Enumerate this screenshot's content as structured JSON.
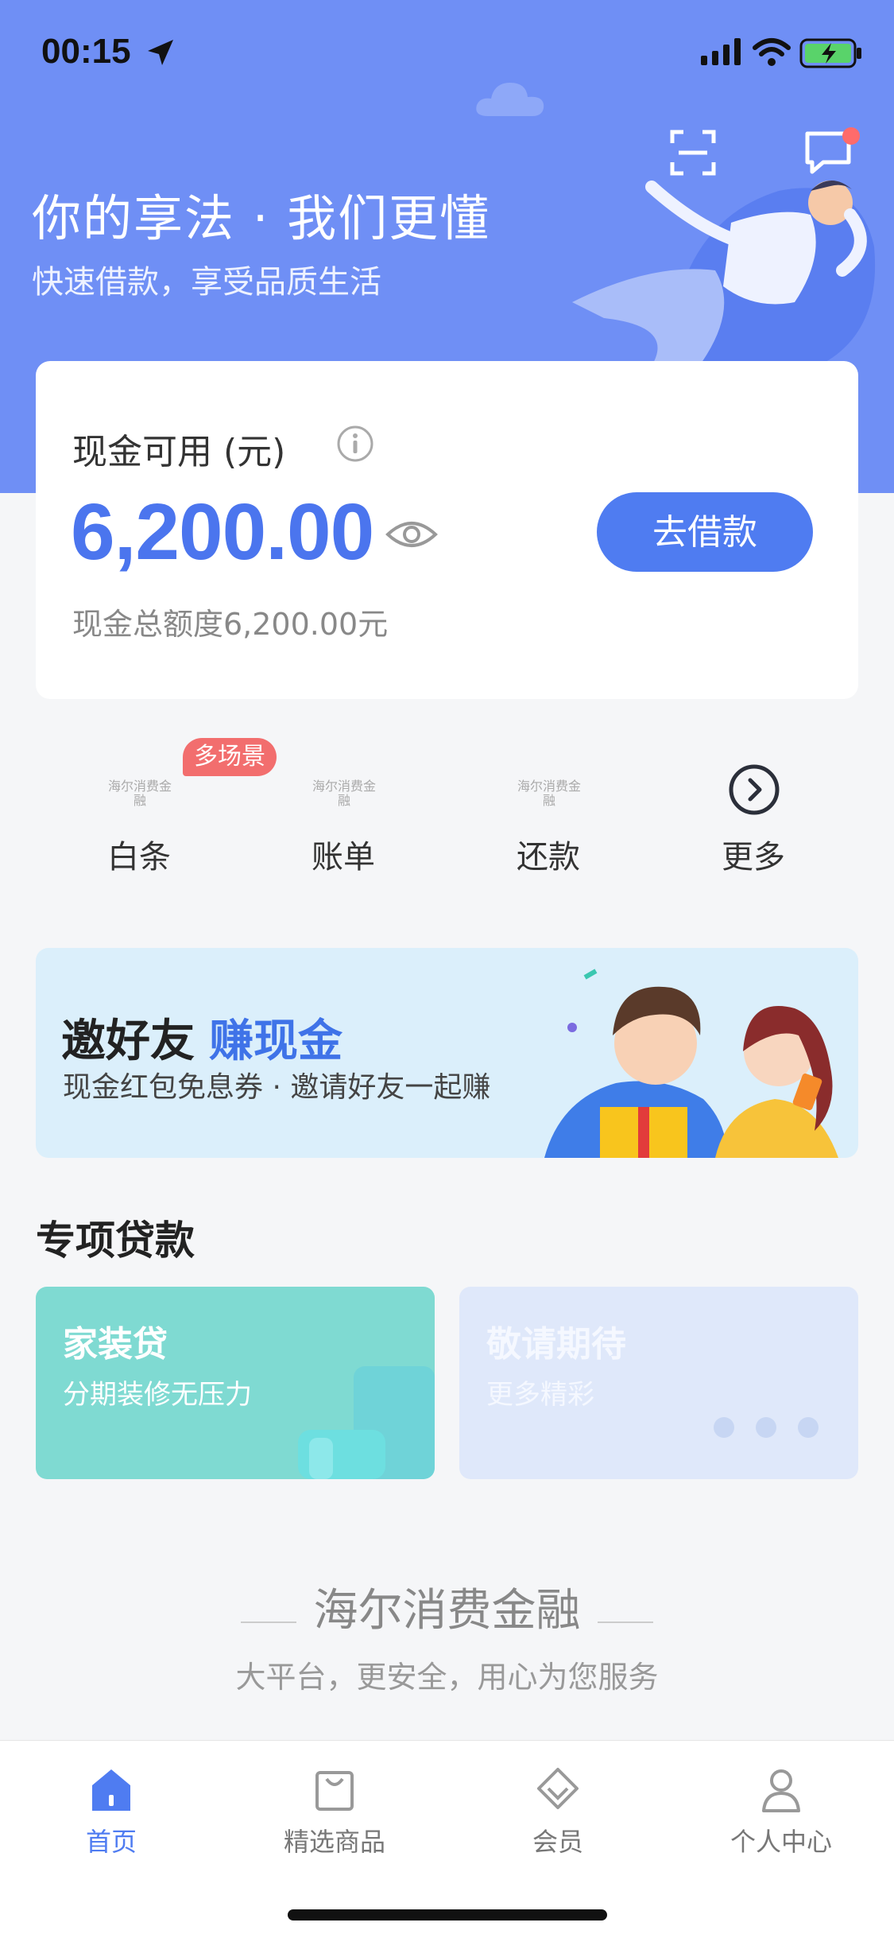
{
  "status_bar": {
    "time": "00:15"
  },
  "hero": {
    "title": "你的享法 · 我们更懂",
    "subtitle": "快速借款，享受品质生活"
  },
  "cash_card": {
    "label": "现金可用 (元)",
    "amount": "6,200.00",
    "borrow_button": "去借款",
    "total_limit": "现金总额度6,200.00元"
  },
  "quick_menu": {
    "items": [
      {
        "label": "白条",
        "logo": "海尔消费金融",
        "badge": "多场景"
      },
      {
        "label": "账单",
        "logo": "海尔消费金融"
      },
      {
        "label": "还款",
        "logo": "海尔消费金融"
      },
      {
        "label": "更多",
        "icon": "chevron-right-circle-icon"
      }
    ]
  },
  "invite_banner": {
    "title": "邀好友",
    "title_accent": "赚现金",
    "subtitle": "现金红包免息券 · 邀请好友一起赚"
  },
  "special_loans": {
    "title": "专项贷款",
    "cards": [
      {
        "title": "家装贷",
        "subtitle": "分期装修无压力"
      },
      {
        "title": "敬请期待",
        "subtitle": "更多精彩"
      }
    ]
  },
  "footer": {
    "brand": "海尔消费金融",
    "slogan": "大平台，更安全，用心为您服务"
  },
  "tab_bar": {
    "tabs": [
      {
        "label": "首页",
        "active": true
      },
      {
        "label": "精选商品"
      },
      {
        "label": "会员"
      },
      {
        "label": "个人中心"
      }
    ]
  },
  "colors": {
    "accent": "#4f7cf1",
    "hero_bg": "#6f8ff5",
    "badge": "#f26e6e",
    "home_loan_card": "#7fdad2"
  }
}
